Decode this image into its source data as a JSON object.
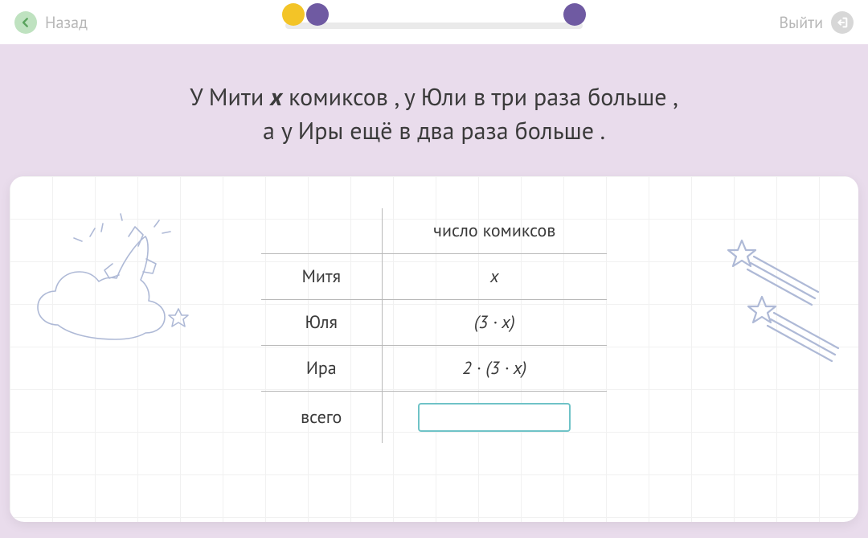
{
  "topbar": {
    "back_label": "Назад",
    "exit_label": "Выйти"
  },
  "prompt": {
    "line1_pre": "У Мити ",
    "line1_var": "x",
    "line1_post": " комиксов ,  у Юли в три раза больше ,",
    "line2": "а у Иры ещё в два раза больше ."
  },
  "table": {
    "header_value": "число комиксов",
    "rows": [
      {
        "label": "Митя",
        "value": "x"
      },
      {
        "label": "Юля",
        "value": "(3 · x)"
      },
      {
        "label": "Ира",
        "value": "2 · (3 · x)"
      }
    ],
    "total_label": "всего",
    "total_value": ""
  }
}
